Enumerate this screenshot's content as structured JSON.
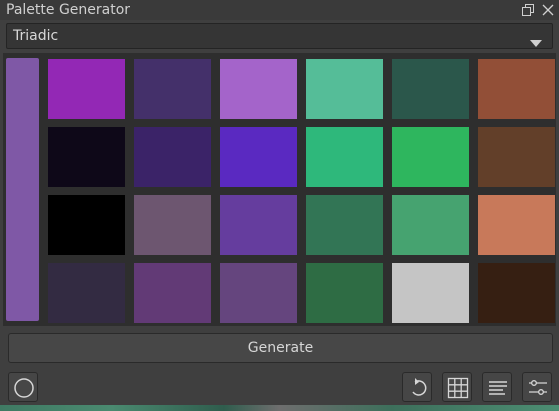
{
  "window": {
    "title": "Palette Generator"
  },
  "scheme_select": {
    "value": "Triadic"
  },
  "base_color": "#7f58a6",
  "swatches": [
    [
      "#9328b5",
      "#44306a",
      "#a464ca",
      "#55bd98",
      "#2b574b",
      "#924f37"
    ],
    [
      "#0e0818",
      "#3b2368",
      "#5a29c1",
      "#2eb87b",
      "#2eb65e",
      "#623f29"
    ],
    [
      "#000000",
      "#6d5670",
      "#653d9e",
      "#327555",
      "#46a370",
      "#c8795a"
    ],
    [
      "#332b42",
      "#623a76",
      "#65457e",
      "#2e6c44",
      "#c5c5c5",
      "#361f12"
    ]
  ],
  "actions": {
    "generate_label": "Generate"
  },
  "icons": {
    "restore": "restore-window-icon",
    "close": "close-icon",
    "dropdown": "chevron-down-icon",
    "circle": "circle-icon",
    "undo": "undo-icon",
    "grid": "grid-icon",
    "list": "list-icon",
    "settings": "sliders-icon"
  }
}
